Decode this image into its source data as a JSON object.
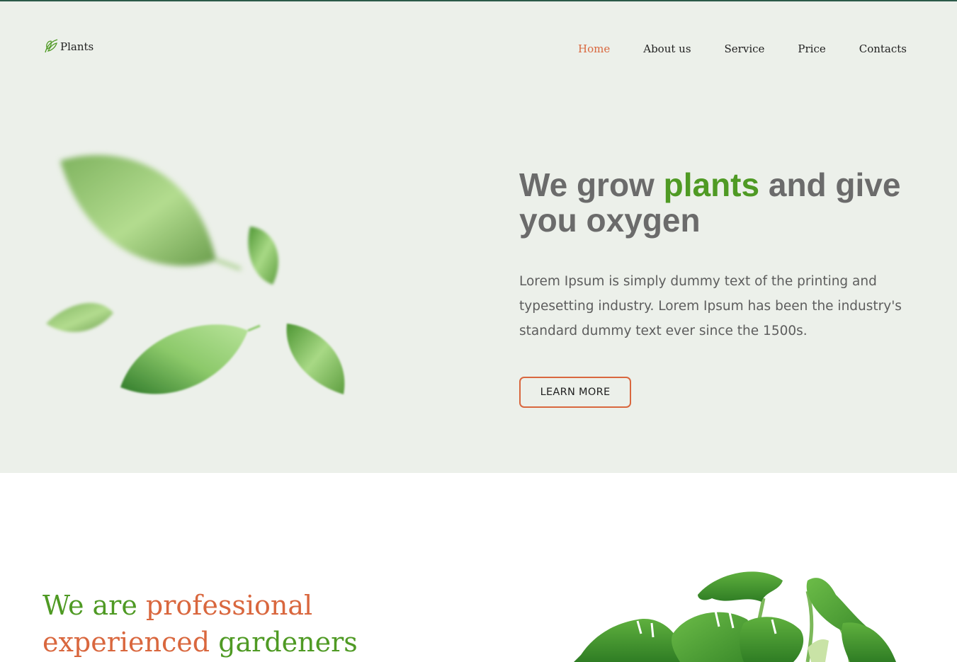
{
  "header": {
    "logo_text": "Plants",
    "logo_icon": "leaf-logo-icon",
    "nav": [
      {
        "label": "Home",
        "active": true
      },
      {
        "label": "About us",
        "active": false
      },
      {
        "label": "Service",
        "active": false
      },
      {
        "label": "Price",
        "active": false
      },
      {
        "label": "Contacts",
        "active": false
      }
    ]
  },
  "hero": {
    "title_part1": "We grow ",
    "title_highlight": "plants",
    "title_part2": " and give you oxygen",
    "description": "Lorem Ipsum is simply dummy text of the printing and typesetting industry. Lorem Ipsum has been the industry's standard dummy text ever since the 1500s.",
    "button_label": "LEARN MORE",
    "image_icon": "falling-leaves-illustration"
  },
  "about": {
    "title_part1": "We are ",
    "title_highlight": "professional experienced",
    "title_part2": " gardeners",
    "image_icon": "monstera-plant-illustration"
  },
  "colors": {
    "accent_green": "#4f9a24",
    "accent_orange": "#d9673e",
    "hero_background": "#ecf0ea",
    "top_line": "#2b5a49"
  }
}
